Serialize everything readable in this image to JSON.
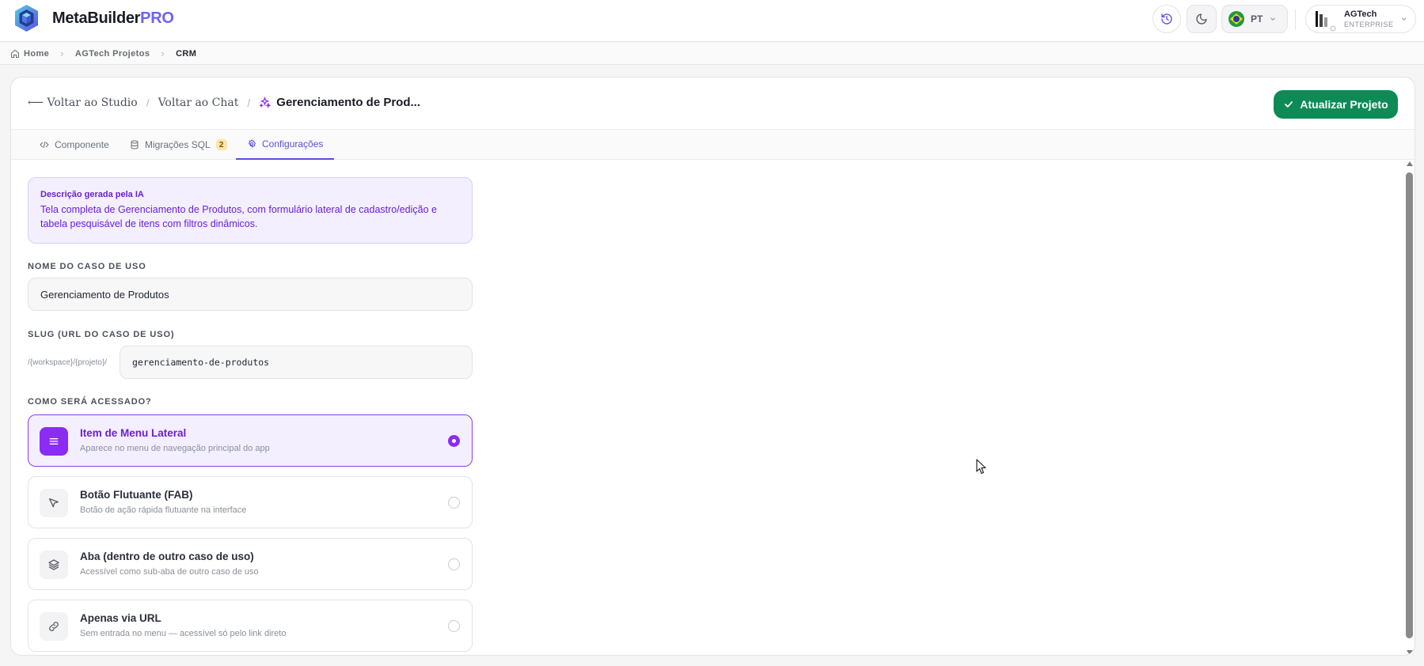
{
  "app": {
    "brand_main": "MetaBuilder",
    "brand_pro": "PRO",
    "language_code": "PT",
    "user_name": "AGTech",
    "user_plan": "ENTERPRISE"
  },
  "breadcrumb": [
    "Home",
    "AGTech Projetos",
    "CRM"
  ],
  "header": {
    "back_studio": "Voltar ao Studio",
    "back_chat": "Voltar ao Chat",
    "title": "Gerenciamento de Prod...",
    "update_button": "Atualizar Projeto"
  },
  "tabs": [
    {
      "label": "Componente"
    },
    {
      "label": "Migrações SQL",
      "badge": "2"
    },
    {
      "label": "Configurações"
    }
  ],
  "ai_description": {
    "label": "Descrição gerada pela IA",
    "text": "Tela completa de Gerenciamento de Produtos, com formulário lateral de cadastro/edição e tabela pesquisável de itens com filtros dinâmicos."
  },
  "form": {
    "name_label": "NOME DO CASO DE USO",
    "name_value": "Gerenciamento de Produtos",
    "slug_label": "SLUG (URL DO CASO DE USO)",
    "slug_prefix": "/{workspace}/{projeto}/",
    "slug_value": "gerenciamento-de-produtos",
    "access_label": "COMO SERÁ ACESSADO?"
  },
  "access_options": [
    {
      "title": "Item de Menu Lateral",
      "description": "Aparece no menu de navegação principal do app",
      "icon": "menu-icon",
      "selected": true
    },
    {
      "title": "Botão Flutuante (FAB)",
      "description": "Botão de ação rápida flutuante na interface",
      "icon": "cursor-pointer-icon",
      "selected": false
    },
    {
      "title": "Aba (dentro de outro caso de uso)",
      "description": "Acessível como sub-aba de outro caso de uso",
      "icon": "layers-icon",
      "selected": false
    },
    {
      "title": "Apenas via URL",
      "description": "Sem entrada no menu — acessível só pelo link direto",
      "icon": "link-icon",
      "selected": false
    }
  ],
  "colors": {
    "accent": "#5b4ee0",
    "primary_purple": "#8b2cf5",
    "update_green": "#0e8a57",
    "brand_pro": "#6c63f0"
  }
}
